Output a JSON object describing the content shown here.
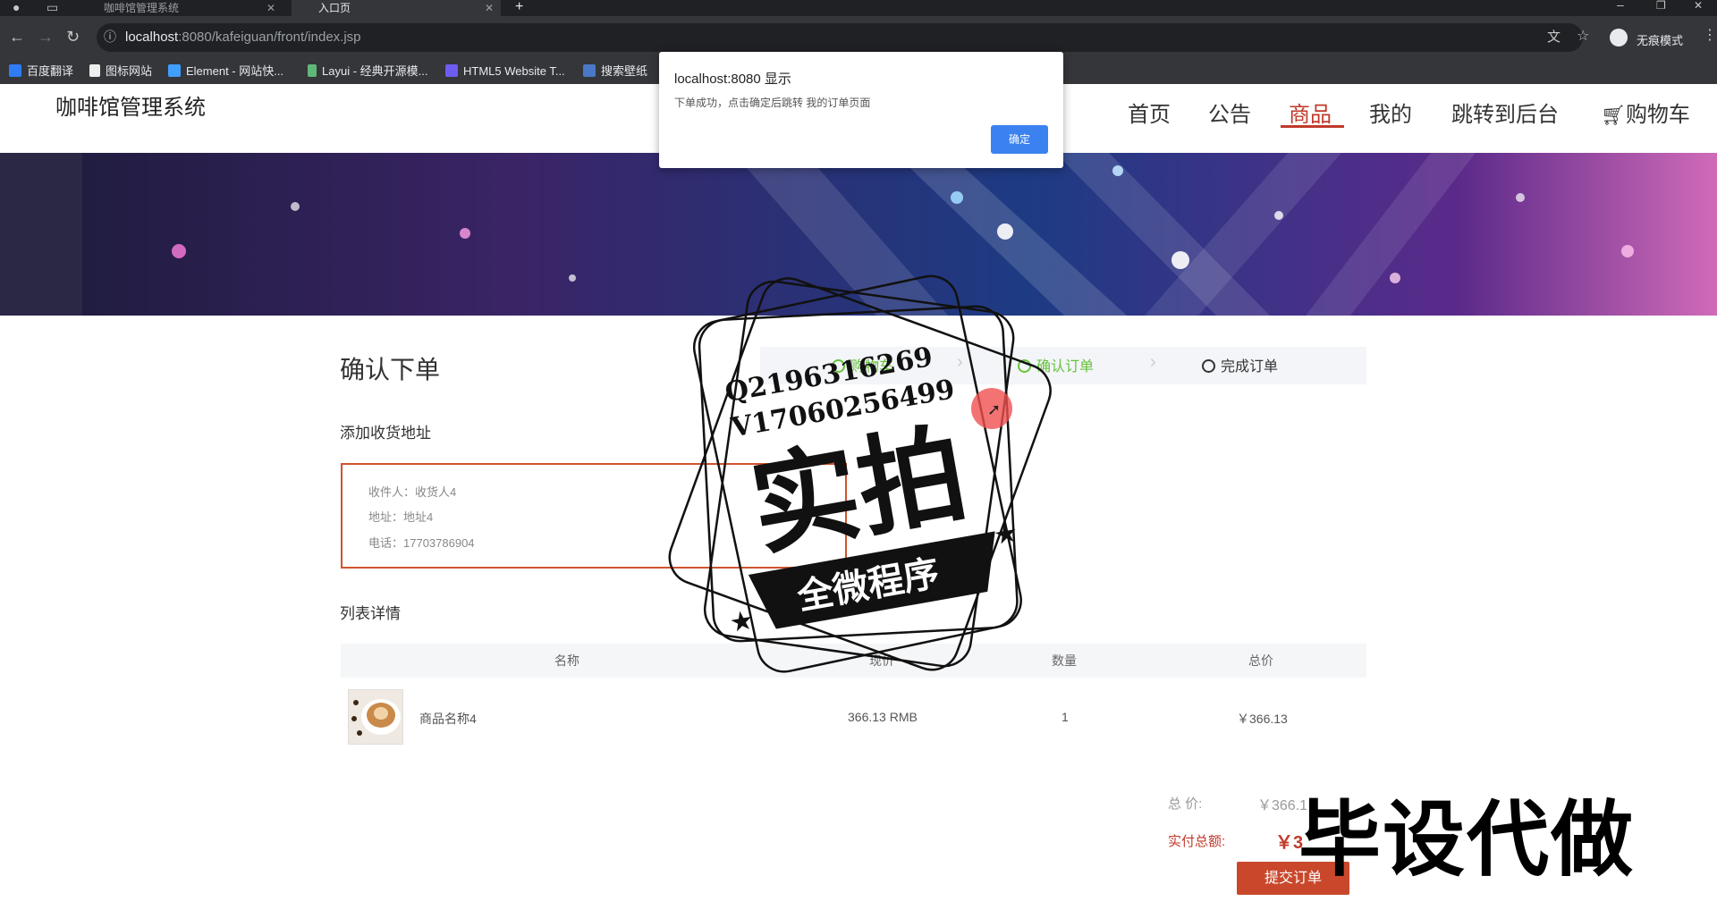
{
  "browser": {
    "tabs": [
      {
        "label": "咖啡馆管理系统",
        "active": false
      },
      {
        "label": "入口页",
        "active": true
      }
    ],
    "url_host": "localhost",
    "url_rest": ":8080/kafeiguan/front/index.jsp",
    "profile_label": "无痕模式",
    "bookmarks": [
      "百度翻译",
      "图标网站",
      "Element - 网站快...",
      "Layui - 经典开源模...",
      "HTML5 Website T...",
      "搜索壁纸"
    ]
  },
  "site": {
    "title": "咖啡馆管理系统",
    "nav": [
      "首页",
      "公告",
      "商品",
      "我的",
      "跳转到后台",
      "购物车"
    ],
    "active_nav": "商品"
  },
  "alert": {
    "title": "localhost:8080 显示",
    "message": "下单成功，点击确定后跳转 我的订单页面",
    "ok_label": "确定"
  },
  "order": {
    "title": "确认下单",
    "steps": [
      "购物车",
      "确认订单",
      "完成订单"
    ],
    "address_section": "添加收货地址",
    "address": {
      "receiver": "收件人：收货人4",
      "addr": "地址：地址4",
      "phone": "电话：17703786904"
    },
    "list_section": "列表详情",
    "table": {
      "headers": [
        "名称",
        "现价",
        "数量",
        "总价"
      ],
      "rows": [
        {
          "name": "商品名称4",
          "price": "366.13 RMB",
          "qty": "1",
          "total": "￥366.13"
        }
      ]
    },
    "summary": {
      "total_label": "总  价:",
      "total_value": "￥366.1",
      "paid_label": "实付总额:",
      "paid_value": "￥3"
    },
    "submit_label": "提交订单"
  },
  "watermark": {
    "qq": "Q2196316269",
    "vx": "V17060256499",
    "stamp_main": "实拍",
    "stamp_banner": "全微程序",
    "big_text": "毕设代做"
  },
  "colors": {
    "accent": "#c0392b",
    "step_done": "#67c23a",
    "alert_button": "#3b82f0"
  }
}
